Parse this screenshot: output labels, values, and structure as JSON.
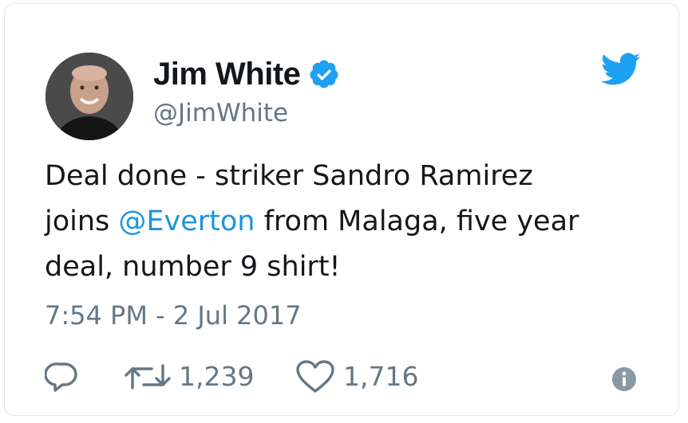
{
  "tweet": {
    "author": {
      "name": "Jim White",
      "handle": "@JimWhite",
      "verified": true,
      "avatar_icon": "avatar-photo"
    },
    "text": {
      "part1": "Deal done - striker Sandro Ramirez\njoins ",
      "mention": "@Everton",
      "part2": " from Malaga, five year\ndeal, number 9 shirt!"
    },
    "timestamp": "7:54 PM - 2 Jul 2017",
    "actions": {
      "reply_icon": "reply-icon",
      "retweet_icon": "retweet-icon",
      "retweet_count": "1,239",
      "like_icon": "heart-icon",
      "like_count": "1,716",
      "info_icon": "info-icon"
    }
  },
  "colors": {
    "brand": "#1da1f2",
    "mention": "#1b95e0",
    "secondary_text": "#657786",
    "text": "#14171a",
    "border": "#e1e8ed"
  }
}
